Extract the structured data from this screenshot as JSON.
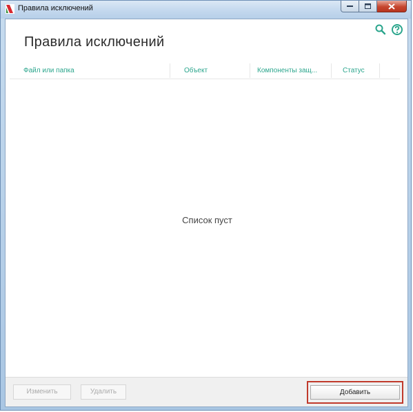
{
  "window": {
    "title": "Правила исключений"
  },
  "page": {
    "title": "Правила исключений"
  },
  "toolbar": {
    "search_icon": "search-icon",
    "help_icon": "help-icon"
  },
  "table": {
    "columns": [
      "Файл или папка",
      "Объект",
      "Компоненты защ...",
      "Статус"
    ],
    "empty_text": "Список пуст"
  },
  "footer": {
    "edit_label": "Изменить",
    "delete_label": "Удалить",
    "add_label": "Добавить"
  },
  "colors": {
    "accent": "#2aa58c",
    "highlight": "#c0392b"
  }
}
